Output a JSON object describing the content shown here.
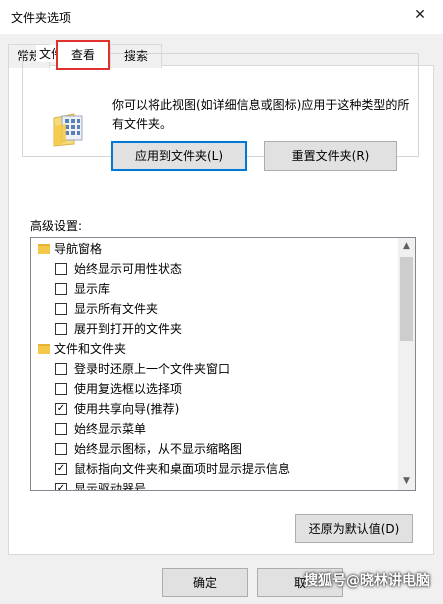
{
  "window": {
    "title": "文件夹选项",
    "close_glyph": "✕"
  },
  "tabs": [
    {
      "label": "常规"
    },
    {
      "label": "查看"
    },
    {
      "label": "搜索"
    }
  ],
  "folder_views": {
    "group_label": "文件夹视图",
    "description": "你可以将此视图(如详细信息或图标)应用于这种类型的所有文件夹。",
    "apply_button": "应用到文件夹(L)",
    "reset_button": "重置文件夹(R)"
  },
  "advanced": {
    "label": "高级设置:",
    "items": [
      {
        "type": "folder",
        "text": "导航窗格"
      },
      {
        "type": "checkbox",
        "text": "始终显示可用性状态",
        "checked": false
      },
      {
        "type": "checkbox",
        "text": "显示库",
        "checked": false
      },
      {
        "type": "checkbox",
        "text": "显示所有文件夹",
        "checked": false
      },
      {
        "type": "checkbox",
        "text": "展开到打开的文件夹",
        "checked": false
      },
      {
        "type": "folder",
        "text": "文件和文件夹"
      },
      {
        "type": "checkbox",
        "text": "登录时还原上一个文件夹窗口",
        "checked": false
      },
      {
        "type": "checkbox",
        "text": "使用复选框以选择项",
        "checked": false
      },
      {
        "type": "checkbox",
        "text": "使用共享向导(推荐)",
        "checked": true
      },
      {
        "type": "checkbox",
        "text": "始终显示菜单",
        "checked": false
      },
      {
        "type": "checkbox",
        "text": "始终显示图标，从不显示缩略图",
        "checked": false
      },
      {
        "type": "checkbox",
        "text": "鼠标指向文件夹和桌面项时显示提示信息",
        "checked": true
      },
      {
        "type": "checkbox",
        "text": "显示驱动器号",
        "checked": true
      }
    ],
    "check_glyph": "✓",
    "scroll_up": "▲",
    "scroll_down": "▼",
    "restore_button": "还原为默认值(D)"
  },
  "footer": {
    "ok_button": "确定",
    "cancel_button": "取"
  },
  "watermark": "搜狐号@晓林讲电脑"
}
